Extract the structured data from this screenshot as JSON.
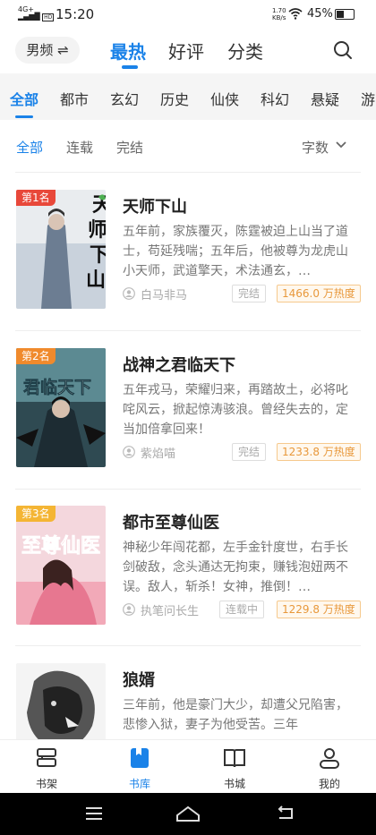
{
  "status": {
    "network": "4G+",
    "time": "15:20",
    "speed_value": "1.70",
    "speed_unit": "KB/s",
    "battery": "45%",
    "hd": "HD"
  },
  "header": {
    "gender_label": "男频",
    "tabs": [
      "最热",
      "好评",
      "分类"
    ],
    "active_tab": "最热"
  },
  "categories": [
    "全部",
    "都市",
    "玄幻",
    "历史",
    "仙侠",
    "科幻",
    "悬疑",
    "游"
  ],
  "filters": {
    "items": [
      "全部",
      "连载",
      "完结"
    ],
    "sort_label": "字数"
  },
  "books": [
    {
      "rank": "第1名",
      "cover_title": "天师下山",
      "title": "天师下山",
      "desc": "五年前，家族覆灭，陈霆被迫上山当了道士，苟延残喘；五年后，他被尊为龙虎山小天师，武道擎天，术法通玄，…",
      "author": "白马非马",
      "state": "完结",
      "heat": "1466.0 万热度"
    },
    {
      "rank": "第2名",
      "cover_title": "君临天下",
      "title": "战神之君临天下",
      "desc": "五年戎马，荣耀归来，再踏故土，必将叱咤风云，掀起惊涛骇浪。曾经失去的，定当加倍拿回来！",
      "author": "紫焰喵",
      "state": "完结",
      "heat": "1233.8 万热度"
    },
    {
      "rank": "第3名",
      "cover_title": "至尊仙医",
      "title": "都市至尊仙医",
      "desc": "神秘少年闯花都，左手金针度世，右手长剑破敌，念头通达无拘束，赚钱泡妞两不误。敌人，斩杀！女神，推倒！…",
      "author": "执笔问长生",
      "state": "连载中",
      "heat": "1229.8 万热度"
    },
    {
      "rank": "",
      "cover_title": "",
      "title": "狼婿",
      "desc": "三年前，他是豪门大少，却遭父兄陷害，悲惨入狱，妻子为他受苦。三年",
      "author": "",
      "state": "",
      "heat": ""
    }
  ],
  "bottom_nav": [
    "书架",
    "书库",
    "书城",
    "我的"
  ],
  "colors": {
    "accent": "#1a82e8",
    "rank1": "#e8483a",
    "rank2": "#f08a2c",
    "rank3": "#f4b534",
    "heat": "#e8983b"
  }
}
